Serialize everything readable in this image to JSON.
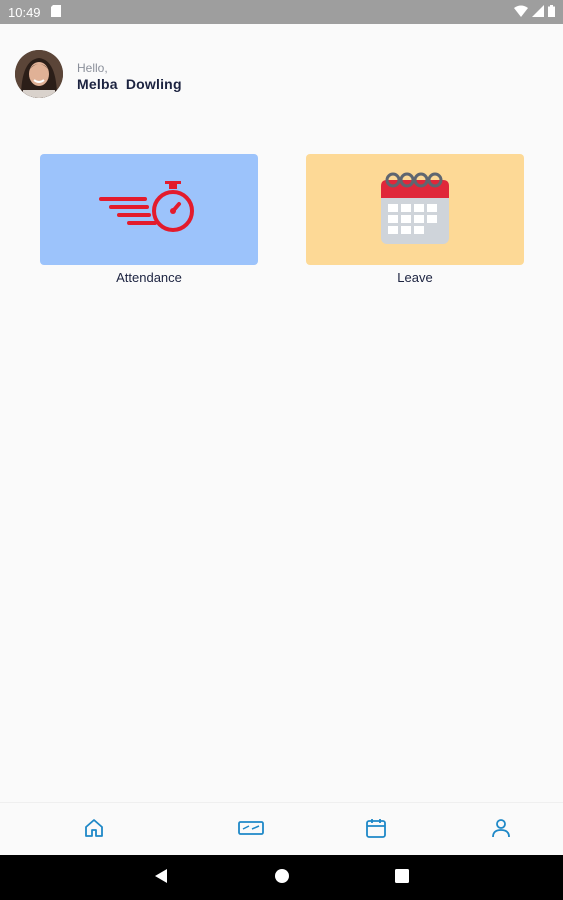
{
  "status_bar": {
    "time": "10:49",
    "icons": [
      "sd-card-icon",
      "wifi-icon",
      "signal-icon",
      "battery-icon"
    ]
  },
  "header": {
    "greeting": "Hello,",
    "user_name": "Melba  Dowling"
  },
  "tiles": [
    {
      "label": "Attendance",
      "icon": "stopwatch-speed-icon",
      "color": "#9cc3fb"
    },
    {
      "label": "Leave",
      "icon": "calendar-icon",
      "color": "#fdd996"
    }
  ],
  "bottom_nav": {
    "items": [
      "home-icon",
      "card-icon",
      "calendar-icon",
      "profile-icon"
    ],
    "accent": "#1e88c7"
  },
  "system_nav": [
    "back-icon",
    "home-circle-icon",
    "recents-icon"
  ]
}
